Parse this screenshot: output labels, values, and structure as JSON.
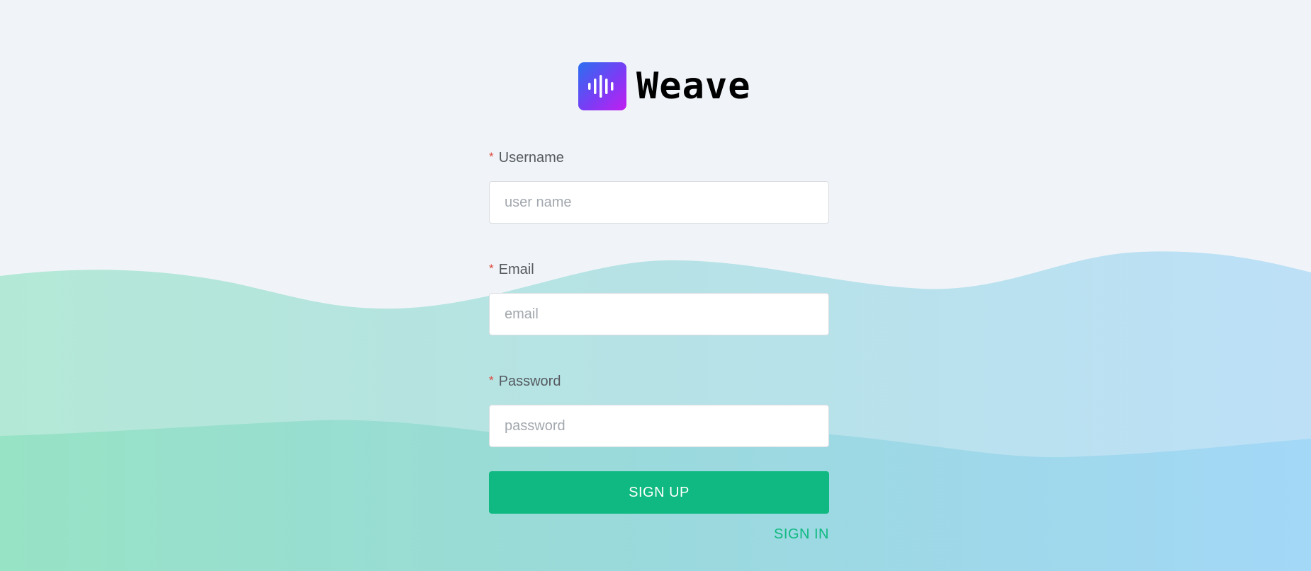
{
  "brand": {
    "logo_icon": "sound-wave-icon",
    "name": "Weave"
  },
  "form": {
    "required_mark": "*",
    "username": {
      "label": "Username",
      "placeholder": "user name",
      "value": ""
    },
    "email": {
      "label": "Email",
      "placeholder": "email",
      "value": ""
    },
    "password": {
      "label": "Password",
      "placeholder": "password",
      "value": ""
    },
    "submit_label": "SIGN UP",
    "switch_label": "SIGN IN"
  },
  "colors": {
    "background": "#f0f4f8",
    "accent": "#10b981",
    "required": "#e0493c",
    "logo_gradient_start": "#2a6ff0",
    "logo_gradient_end": "#c21ff0"
  }
}
